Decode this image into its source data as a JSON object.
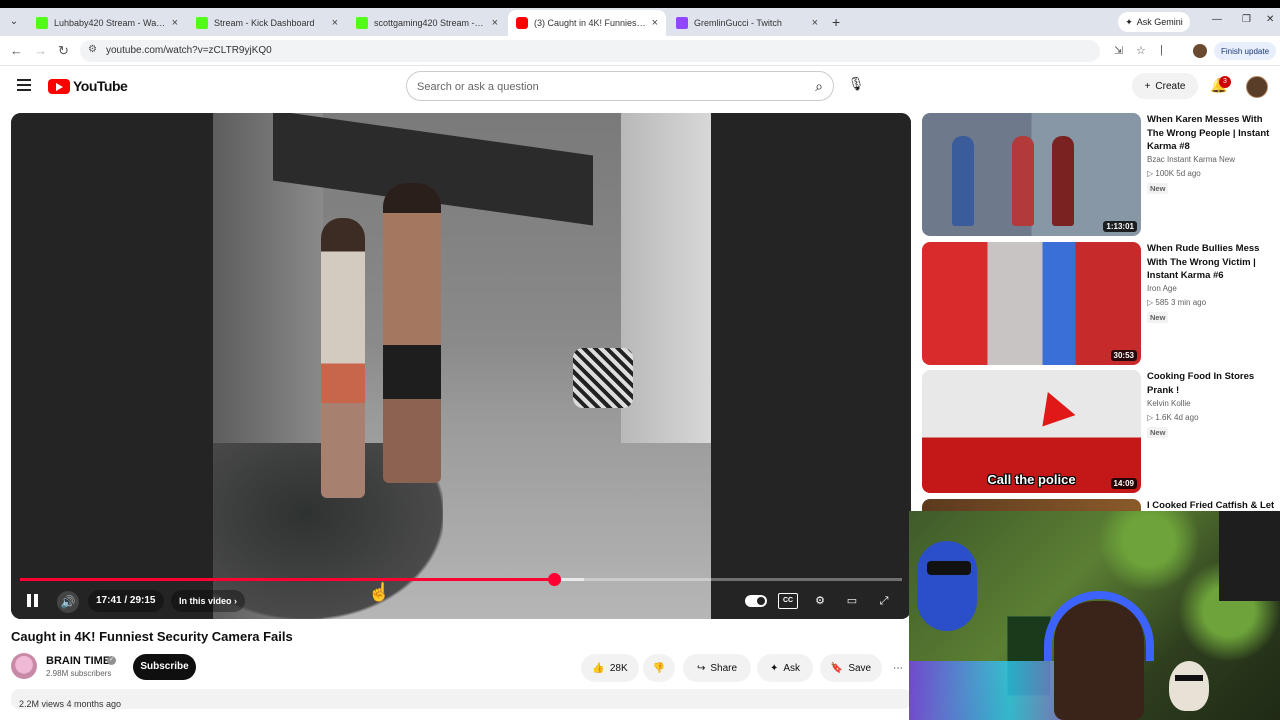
{
  "browser": {
    "tabs": [
      {
        "title": "Luhbaby420 Stream - Watch Li...",
        "icon": "kick-icon"
      },
      {
        "title": "Stream - Kick Dashboard",
        "icon": "kick-icon"
      },
      {
        "title": "scottgaming420 Stream - W...",
        "icon": "kick-icon"
      },
      {
        "title": "(3) Caught in 4K! Funniest S...",
        "icon": "youtube-icon"
      },
      {
        "title": "GremlinGucci - Twitch",
        "icon": "twitch-icon"
      }
    ],
    "ask_gemini": "Ask Gemini",
    "url": "youtube.com/watch?v=zCLTR9yjKQ0",
    "finish_update": "Finish update"
  },
  "youtube": {
    "logo_text": "YouTube",
    "search_placeholder": "Search or ask a question",
    "create_label": "Create",
    "notification_count": "3"
  },
  "player": {
    "time": "17:41 / 29:15",
    "chapter_label": "In this video",
    "progress_fraction": 0.605,
    "buffer_fraction": 0.64
  },
  "video": {
    "title": "Caught in 4K! Funniest Security Camera Fails",
    "channel": "BRAIN TIME",
    "subscribers": "2.98M subscribers",
    "subscribe_label": "Subscribe",
    "likes": "28K",
    "share_label": "Share",
    "ask_label": "Ask",
    "save_label": "Save",
    "views_partial": "2.2M views  4 months ago"
  },
  "recommendations": [
    {
      "title": "When Karen Messes With The Wrong People | Instant Karma #8",
      "channel": "Bzac Instant Karma New",
      "meta": "▷ 100K  5d ago",
      "badge": "New",
      "duration": "1:13:01"
    },
    {
      "title": "When Rude Bullies Mess With The Wrong Victim | Instant Karma #6",
      "channel": "Iron Age",
      "meta": "▷ 585  3 min ago",
      "badge": "New",
      "duration": "30:53"
    },
    {
      "title": "Cooking Food In Stores Prank !",
      "channel": "Kelvin Kollie",
      "meta": "▷ 1.6K  4d ago",
      "badge": "New",
      "duration": "14:09",
      "overlay": "Call the police"
    },
    {
      "title": "I Cooked Fried Catfish & Let"
    }
  ]
}
